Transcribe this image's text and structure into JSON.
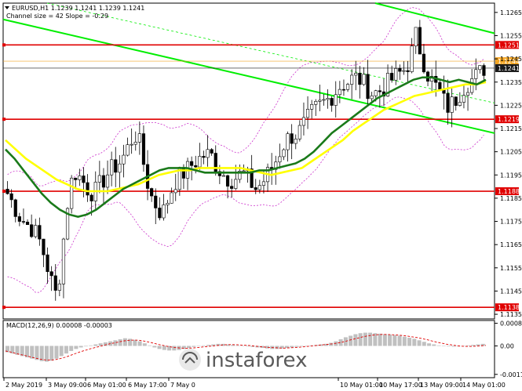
{
  "chart_data": {
    "type": "candlestick",
    "symbol_line": "EURUSD,H1  1.1239 1.1241 1.1239 1.1241",
    "channel_line": "Channel size = 42 Slope = -0.29",
    "y_ticks": [
      "1.1265",
      "1.1255",
      "1.1245",
      "1.1235",
      "1.1225",
      "1.1215",
      "1.1205",
      "1.1195",
      "1.1185",
      "1.1175",
      "1.1165",
      "1.1155",
      "1.1145",
      "1.1135"
    ],
    "ylim": [
      1.1133,
      1.1269
    ],
    "x_ticks": [
      "2 May 2019",
      "3 May 09:00",
      "6 May 01:00",
      "6 May 17:00",
      "7 May 0",
      "10 May 01:00",
      "10 May 17:00",
      "13 May 09:00",
      "14 May 01:00"
    ],
    "levels": [
      {
        "label": "1.1251",
        "value": 1.1251,
        "color": "#e00000"
      },
      {
        "label": "1.1244",
        "value": 1.1244,
        "color": "#f5a623"
      },
      {
        "label": "1.1241",
        "value": 1.1241,
        "color": "#1a1a1a"
      },
      {
        "label": "1.1219",
        "value": 1.1219,
        "color": "#e00000"
      },
      {
        "label": "1.1188",
        "value": 1.1188,
        "color": "#e00000"
      },
      {
        "label": "1.1138",
        "value": 1.1138,
        "color": "#e00000"
      }
    ],
    "series": [
      {
        "values": [
          1.1187,
          1.1182,
          1.1177,
          1.1174,
          1.1172,
          1.1168,
          1.116,
          1.115,
          1.1142,
          1.1166,
          1.119,
          1.1196,
          1.1193,
          1.1189,
          1.1187,
          1.1191,
          1.1195,
          1.1198,
          1.12,
          1.1204,
          1.121,
          1.1213,
          1.12,
          1.1187,
          1.1182,
          1.1178,
          1.1185,
          1.1192,
          1.1195,
          1.1197,
          1.12,
          1.1202,
          1.1204,
          1.1203,
          1.1198,
          1.1195,
          1.1193,
          1.1194,
          1.1196,
          1.1193,
          1.1189,
          1.1191,
          1.1195,
          1.1199,
          1.1205,
          1.121,
          1.1212,
          1.1213,
          1.1217,
          1.1221,
          1.1224,
          1.1226,
          1.1228,
          1.1231,
          1.1234,
          1.1235,
          1.1237,
          1.1236,
          1.1233,
          1.123,
          1.1231,
          1.1233,
          1.1236,
          1.1238,
          1.124,
          1.1244,
          1.1255,
          1.1246,
          1.1238,
          1.1234,
          1.123,
          1.1224,
          1.1226,
          1.123,
          1.1234,
          1.1236,
          1.1238,
          1.1241
        ]
      },
      {
        "values": [
          1.1206,
          1.1202,
          1.1197,
          1.1192,
          1.1187,
          1.1183,
          1.118,
          1.1178,
          1.1177,
          1.1178,
          1.118,
          1.1183,
          1.1186,
          1.1189,
          1.1191,
          1.1193,
          1.1195,
          1.1197,
          1.1198,
          1.1198,
          1.1198,
          1.1197,
          1.1196,
          1.1196,
          1.1196,
          1.1196,
          1.1196,
          1.1196,
          1.1197,
          1.1197,
          1.1198,
          1.1199,
          1.12,
          1.1202,
          1.1205,
          1.1209,
          1.1213,
          1.1216,
          1.1219,
          1.1222,
          1.1225,
          1.1228,
          1.123,
          1.1232,
          1.1234,
          1.1236,
          1.1237,
          1.1237,
          1.1236,
          1.1235,
          1.1236,
          1.1235,
          1.1234,
          1.1236
        ]
      },
      {
        "values": [
          1.121,
          1.1206,
          1.1202,
          1.1199,
          1.1196,
          1.1193,
          1.1191,
          1.1189,
          1.1188,
          1.1188,
          1.1188,
          1.1189,
          1.119,
          1.1191,
          1.1193,
          1.1195,
          1.1196,
          1.1197,
          1.1197,
          1.1198,
          1.1198,
          1.1198,
          1.1198,
          1.1198,
          1.1197,
          1.1196,
          1.1195,
          1.1196,
          1.1197,
          1.1198,
          1.1201,
          1.1204,
          1.1207,
          1.121,
          1.1214,
          1.1217,
          1.122,
          1.1223,
          1.1225,
          1.1227,
          1.1229,
          1.123,
          1.1231,
          1.1232,
          1.1233,
          1.1234,
          1.1234,
          1.1235
        ]
      }
    ],
    "macd": {
      "label": "MACD(12,26,9) 0.00008 -0.00003",
      "y_ticks": [
        "0.00089",
        "0.00",
        "-0.00112"
      ],
      "ylim": [
        -0.00125,
        0.001
      ],
      "hist": [
        -0.00025,
        -0.0003,
        -0.00035,
        -0.0004,
        -0.00045,
        -0.0005,
        -0.00055,
        -0.0006,
        -0.00062,
        -0.00058,
        -0.0005,
        -0.0004,
        -0.0003,
        -0.0002,
        -0.00012,
        -6e-05,
        -2e-05,
        2e-05,
        6e-05,
        0.0001,
        0.00014,
        0.00018,
        0.00022,
        0.00026,
        0.0003,
        0.00028,
        0.00024,
        0.00018,
        0.0001,
        2e-05,
        -6e-05,
        -0.00012,
        -0.00016,
        -0.00018,
        -0.00018,
        -0.00016,
        -0.00012,
        -8e-05,
        -4e-05,
        0.0,
        2e-05,
        4e-05,
        6e-05,
        8e-05,
        8e-05,
        6e-05,
        4e-05,
        2e-05,
        0.0,
        -2e-05,
        -4e-05,
        -6e-05,
        -8e-05,
        -0.0001,
        -0.00012,
        -0.00012,
        -0.0001,
        -8e-05,
        -6e-05,
        -4e-05,
        -2e-05,
        0.0,
        2e-05,
        4e-05,
        6e-05,
        8e-05,
        0.00012,
        0.00018,
        0.00026,
        0.00034,
        0.0004,
        0.00046,
        0.0005,
        0.00052,
        0.00052,
        0.0005,
        0.00048,
        0.00046,
        0.00044,
        0.00042,
        0.0004,
        0.00036,
        0.00032,
        0.00028,
        0.00022,
        0.00016,
        0.0001,
        6e-05,
        2e-05,
        0.0,
        -2e-05,
        -3e-05,
        -2e-05,
        0.0,
        2e-05,
        4e-05,
        6e-05,
        8e-05
      ],
      "signal": [
        -0.0002,
        -0.00024,
        -0.00029,
        -0.00034,
        -0.00038,
        -0.00043,
        -0.00048,
        -0.00052,
        -0.00055,
        -0.00056,
        -0.00054,
        -0.0005,
        -0.00045,
        -0.00038,
        -0.00031,
        -0.00024,
        -0.00018,
        -0.00012,
        -7e-05,
        -2e-05,
        3e-05,
        8e-05,
        0.00012,
        0.00016,
        0.0002,
        0.00022,
        0.00023,
        0.00022,
        0.00019,
        0.00015,
        0.0001,
        5e-05,
        1e-05,
        -3e-05,
        -6e-05,
        -8e-05,
        -9e-05,
        -9e-05,
        -8e-05,
        -6e-05,
        -4e-05,
        -2e-05,
        0.0,
        2e-05,
        4e-05,
        5e-05,
        5e-05,
        4e-05,
        3e-05,
        2e-05,
        0.0,
        -2e-05,
        -4e-05,
        -6e-05,
        -7e-05,
        -8e-05,
        -9e-05,
        -8e-05,
        -7e-05,
        -6e-05,
        -4e-05,
        -2e-05,
        0.0,
        2e-05,
        4e-05,
        6e-05,
        8e-05,
        0.00011,
        0.00015,
        0.0002,
        0.00025,
        0.0003,
        0.00035,
        0.00039,
        0.00042,
        0.00044,
        0.00045,
        0.00045,
        0.00044,
        0.00043,
        0.00041,
        0.00039,
        0.00036,
        0.00033,
        0.00029,
        0.00025,
        0.0002,
        0.00015,
        0.00011,
        7e-05,
        4e-05,
        1e-05,
        -1e-05,
        -2e-05,
        -2e-05,
        -1e-05,
        0.0,
        2e-05
      ]
    },
    "colors": {
      "up_candle": "#000000",
      "down_candle": "#000000",
      "ma_green": "#1a7a1a",
      "ma_yellow": "#ffff00",
      "channel": "#00ee00",
      "bands": "#cc33cc",
      "macd_hist": "#c0c0c0",
      "macd_signal": "#e00000"
    },
    "grid": false
  },
  "watermark": "instaforex"
}
